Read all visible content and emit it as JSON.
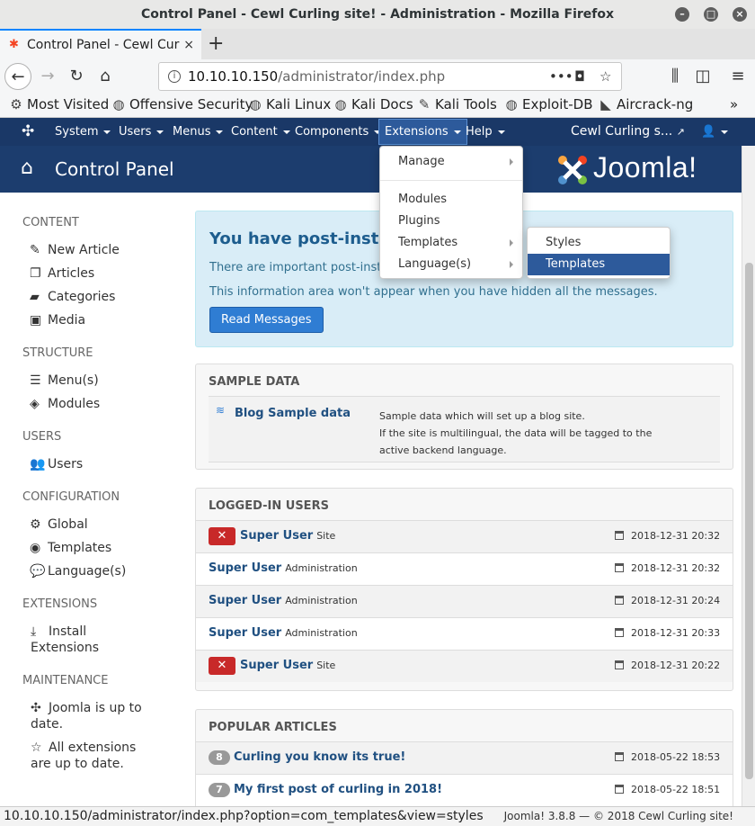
{
  "window": {
    "title": "Control Panel - Cewl Curling site! - Administration - Mozilla Firefox"
  },
  "tab": {
    "label": "Control Panel - Cewl Cur",
    "close": "×",
    "new_tab": "+"
  },
  "address": {
    "host": "10.10.10.150",
    "path": "/administrator/index.php",
    "more": "•••"
  },
  "bookmarks": [
    {
      "label": "Most Visited",
      "icon": "gear-icon"
    },
    {
      "label": "Offensive Security",
      "icon": "globe-icon"
    },
    {
      "label": "Kali Linux",
      "icon": "globe-icon"
    },
    {
      "label": "Kali Docs",
      "icon": "globe-icon"
    },
    {
      "label": "Kali Tools",
      "icon": "tools-icon"
    },
    {
      "label": "Exploit-DB",
      "icon": "globe-icon"
    },
    {
      "label": "Aircrack-ng",
      "icon": "antenna-icon"
    }
  ],
  "joomla_menu": {
    "items": [
      "System",
      "Users",
      "Menus",
      "Content",
      "Components",
      "Extensions",
      "Help"
    ],
    "site_link": "Cewl Curling s...",
    "active": "Extensions"
  },
  "header": {
    "title": "Control Panel",
    "logo": "Joomla!"
  },
  "sidebar": {
    "content": {
      "heading": "CONTENT",
      "items": [
        "New Article",
        "Articles",
        "Categories",
        "Media"
      ]
    },
    "structure": {
      "heading": "STRUCTURE",
      "items": [
        "Menu(s)",
        "Modules"
      ]
    },
    "users": {
      "heading": "USERS",
      "items": [
        "Users"
      ]
    },
    "configuration": {
      "heading": "CONFIGURATION",
      "items": [
        "Global",
        "Templates",
        "Language(s)"
      ]
    },
    "extensions": {
      "heading": "EXTENSIONS",
      "items": [
        "Install Extensions"
      ]
    },
    "maintenance": {
      "heading": "MAINTENANCE",
      "items": [
        "Joomla is up to date.",
        "All extensions are up to date."
      ]
    }
  },
  "alert": {
    "title": "You have post-installa",
    "line1": "There are important post-installat",
    "line2": "This information area won't appear when you have hidden all the messages.",
    "button": "Read Messages"
  },
  "sample_data": {
    "heading": "SAMPLE DATA",
    "item": "Blog Sample data",
    "desc1": "Sample data which will set up a blog site.",
    "desc2": "If the site is multilingual, the data will be tagged to the",
    "desc3": "active backend language."
  },
  "logged_in": {
    "heading": "LOGGED-IN USERS",
    "rows": [
      {
        "name": "Super User",
        "type": "Site",
        "date": "2018-12-31 20:32",
        "logout": true
      },
      {
        "name": "Super User",
        "type": "Administration",
        "date": "2018-12-31 20:32",
        "logout": false
      },
      {
        "name": "Super User",
        "type": "Administration",
        "date": "2018-12-31 20:24",
        "logout": false
      },
      {
        "name": "Super User",
        "type": "Administration",
        "date": "2018-12-31 20:33",
        "logout": false
      },
      {
        "name": "Super User",
        "type": "Site",
        "date": "2018-12-31 20:22",
        "logout": true
      }
    ]
  },
  "popular": {
    "heading": "POPULAR ARTICLES",
    "rows": [
      {
        "hits": "8",
        "title": "Curling you know its true!",
        "date": "2018-05-22 18:53"
      },
      {
        "hits": "7",
        "title": "My first post of curling in 2018!",
        "date": "2018-05-22 18:51"
      }
    ]
  },
  "extensions_menu": {
    "items": [
      "Manage",
      "Modules",
      "Plugins",
      "Templates",
      "Language(s)"
    ],
    "templates_submenu": [
      "Styles",
      "Templates"
    ],
    "highlighted": "Templates"
  },
  "statusbar": {
    "url": "10.10.10.150/administrator/index.php?option=com_templates&view=styles",
    "footer": "Joomla! 3.8.8 — © 2018 Cewl Curling site!"
  },
  "colors": {
    "navy": "#1a3867",
    "accent": "#2d5a9b",
    "alert_bg": "#d9edf7",
    "danger": "#c82929"
  }
}
